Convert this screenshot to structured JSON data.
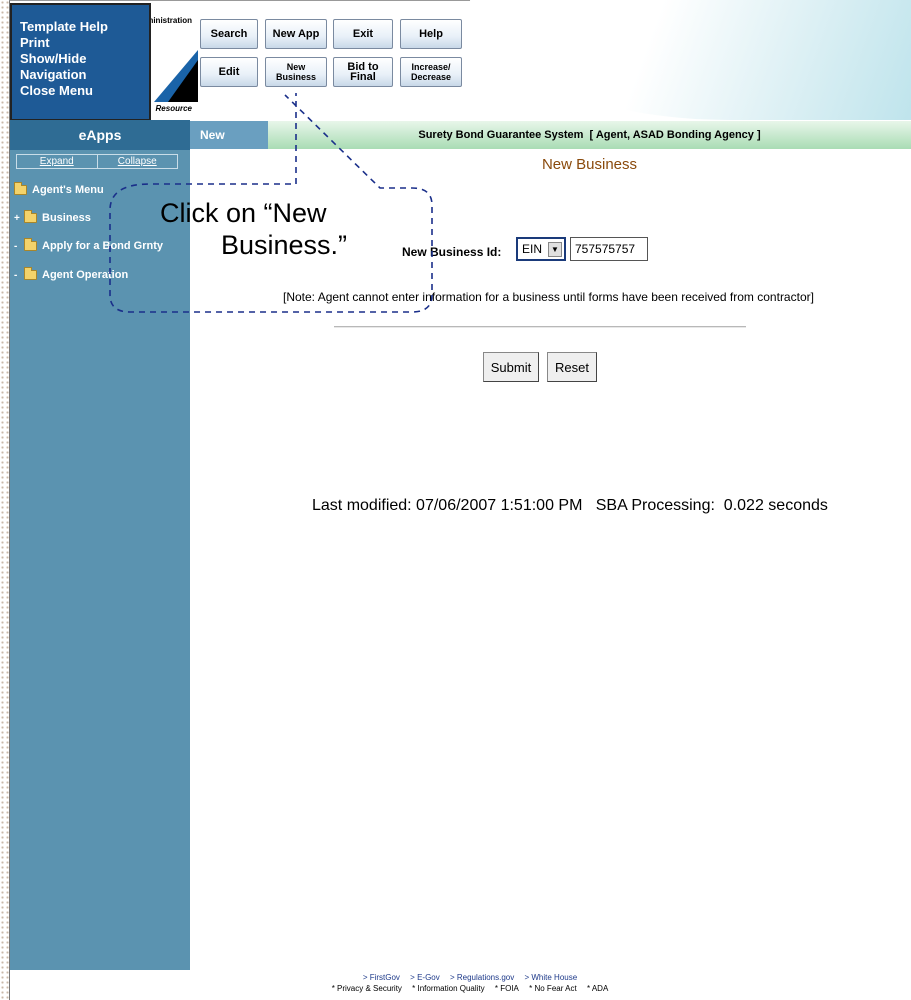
{
  "popup_menu": {
    "items": [
      "Template Help",
      "Print",
      "Show/Hide Navigation",
      "Close Menu"
    ]
  },
  "logo": {
    "text_top": "ministration",
    "text_bottom": "Resource"
  },
  "toolbar": {
    "row1": [
      "Search",
      "New App",
      "Exit",
      "Help"
    ],
    "row2": [
      "Edit",
      "New\nBusiness",
      "Bid to Final",
      "Increase/\nDecrease"
    ]
  },
  "nav": {
    "eapps_label": "eApps",
    "new_tab": "New",
    "system_title": "Surety Bond Guarantee System  [ Agent, ASAD Bonding Agency ]"
  },
  "sidebar": {
    "expand": "Expand",
    "collapse": "Collapse",
    "items": [
      {
        "mark": "",
        "label": "Agent's Menu"
      },
      {
        "mark": "+",
        "label": "Business"
      },
      {
        "mark": "-",
        "label": "Apply for a Bond Grnty"
      },
      {
        "mark": "-",
        "label": "Agent Operation"
      }
    ]
  },
  "main": {
    "heading": "New Business",
    "field_label": "New Business Id:",
    "id_type": "EIN",
    "id_value": "757575757",
    "note": "[Note: Agent cannot enter information for a business until forms have been received from contractor]",
    "submit": "Submit",
    "reset": "Reset",
    "last_modified": "Last modified: 07/06/2007 1:51:00 PM   SBA Processing:  0.022 seconds"
  },
  "footer": {
    "links_row1": [
      "> FirstGov",
      "> E-Gov",
      "> Regulations.gov",
      "> White House"
    ],
    "links_row2": [
      "* Privacy & Security",
      "* Information Quality",
      "* FOIA",
      "* No Fear Act",
      "* ADA"
    ]
  },
  "callout": {
    "line1": "Click on “New",
    "line2": "Business.”"
  },
  "colors": {
    "popup_bg": "#1e5a96",
    "sidebar_bg": "#5b93b0",
    "eapps_bar": "#2f6c94",
    "title_bar": "#a9dcb4",
    "heading": "#8a4a0c"
  }
}
